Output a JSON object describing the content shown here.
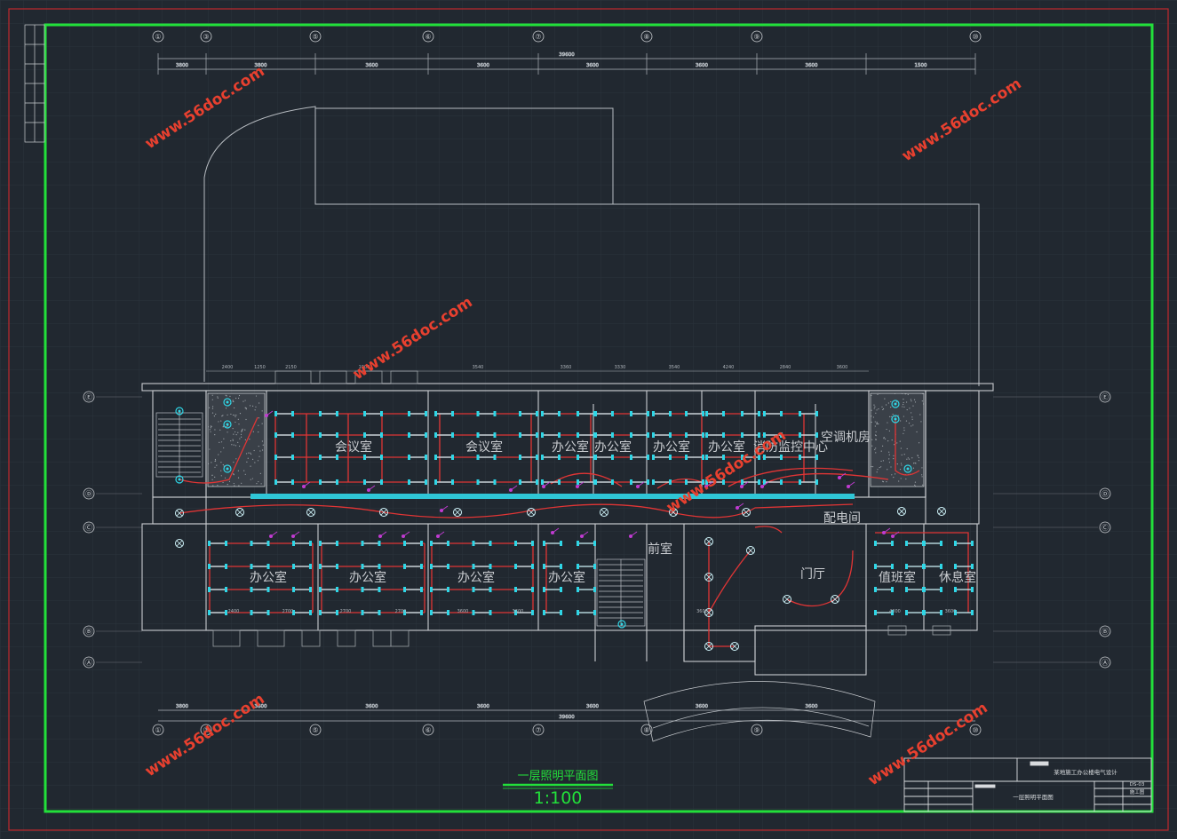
{
  "drawing": {
    "title": "一层照明平面图",
    "scale": "1:100"
  },
  "watermark": "www.56doc.com",
  "grid_top": [
    "①",
    "③",
    "⑤",
    "⑥",
    "⑦",
    "⑧",
    "⑨",
    "⑩"
  ],
  "dims_top": [
    "3800",
    "3800",
    "3600",
    "3600",
    "3600",
    "3600",
    "3600",
    "1500",
    "2800"
  ],
  "dims_top_total": "39600",
  "dims_bottom": [
    "3800",
    "3600",
    "3600",
    "3600",
    "3600",
    "3600",
    "3600"
  ],
  "dims_bottom_total": "39600",
  "grid_left": [
    "Ⓔ",
    "Ⓓ",
    "Ⓒ",
    "Ⓑ",
    "Ⓐ"
  ],
  "rooms": {
    "meeting1": "会议室",
    "meeting2": "会议室",
    "office_n1": "办公室",
    "office_n2": "办公室",
    "office_n3": "办公室",
    "office_n4": "办公室",
    "fire_control": "消防监控中心",
    "ac_room": "空调机房",
    "power_room": "配电间",
    "office_s1": "办公室",
    "office_s2": "办公室",
    "office_s3": "办公室",
    "office_s4": "办公室",
    "front": "前室",
    "lobby": "门厅",
    "duty": "值班室",
    "rest": "休息室"
  },
  "north_dims": [
    "2400",
    "1250",
    "2150",
    "1000",
    "3540",
    "3360",
    "3330",
    "3540",
    "4240",
    "2840",
    "3600"
  ],
  "south_dims": [
    "2400",
    "2700",
    "2700",
    "2700",
    "3600",
    "3600",
    "3600",
    "4000",
    "3600"
  ],
  "titleblock": {
    "project": "某地施工办公楼电气设计",
    "sheet_name": "一层照明平面图",
    "sheet_no": "DS-03",
    "stage": "施工图"
  }
}
